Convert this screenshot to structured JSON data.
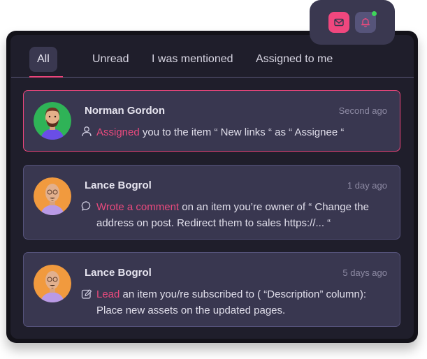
{
  "tabs": [
    {
      "label": "All",
      "active": true
    },
    {
      "label": "Unread",
      "active": false
    },
    {
      "label": "I was mentioned",
      "active": false
    },
    {
      "label": "Assigned to me",
      "active": false
    }
  ],
  "popover": {
    "buttons": [
      {
        "icon": "mail-icon",
        "active": true
      },
      {
        "icon": "bell-icon",
        "active": false,
        "has_indicator": true
      }
    ]
  },
  "colors": {
    "accent": "#ea4a7d",
    "indicator": "#3ed65a"
  },
  "notifications": [
    {
      "name": "Norman Gordon",
      "time": "Second ago",
      "icon": "user-icon",
      "action": "Assigned",
      "text": " you to the item “ New links “ as “ Assignee “",
      "highlighted": true
    },
    {
      "name": "Lance Bogrol",
      "time": "1 day ago",
      "icon": "comment-icon",
      "action": "Wrote a comment",
      "text": " on an item you’re owner of “ Change the address on post. Redirect them to sales https://... “",
      "highlighted": false
    },
    {
      "name": "Lance Bogrol",
      "time": "5 days ago",
      "icon": "edit-icon",
      "action": "Lead",
      "text": " an item you/re subscribed to ( “Description” column): Place new assets on the updated pages.",
      "highlighted": false
    }
  ]
}
